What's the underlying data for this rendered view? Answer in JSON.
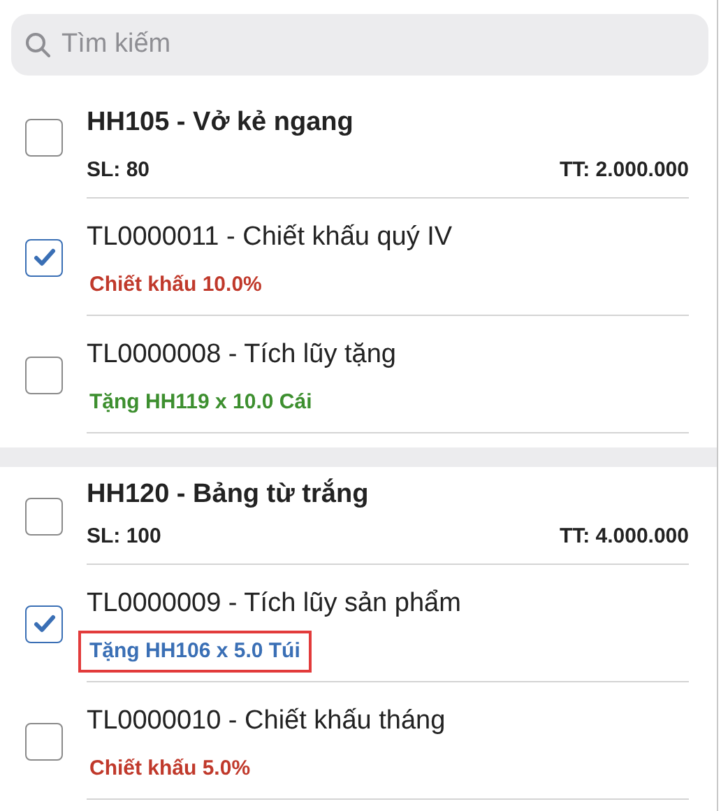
{
  "search": {
    "placeholder": "Tìm kiếm"
  },
  "groups": [
    {
      "product": {
        "title": "HH105 - Vở kẻ ngang",
        "checked": false,
        "quantity": "SL: 80",
        "total": "TT: 2.000.000"
      },
      "promotions": [
        {
          "title": "TL0000011 - Chiết khấu quý IV",
          "checked": true,
          "detail": "Chiết khấu 10.0%",
          "color": "#c0392b",
          "highlighted": false
        },
        {
          "title": "TL0000008 - Tích lũy tặng",
          "checked": false,
          "detail": "Tặng HH119 x 10.0 Cái",
          "color": "#3d8f2f",
          "highlighted": false
        }
      ]
    },
    {
      "product": {
        "title": "HH120 - Bảng từ trắng",
        "checked": false,
        "quantity": "SL: 100",
        "total": "TT: 4.000.000"
      },
      "promotions": [
        {
          "title": "TL0000009 - Tích lũy sản phẩm",
          "checked": true,
          "detail": "Tặng HH106 x 5.0 Túi",
          "color": "#3a6fb5",
          "highlighted": true
        },
        {
          "title": "TL0000010 - Chiết khấu tháng",
          "checked": false,
          "detail": "Chiết khấu 5.0%",
          "color": "#c0392b",
          "highlighted": false
        }
      ]
    }
  ]
}
